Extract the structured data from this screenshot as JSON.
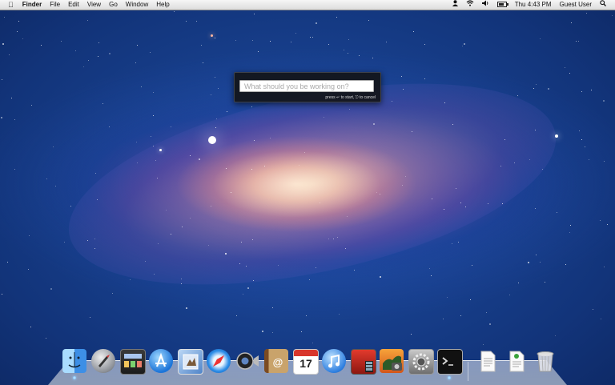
{
  "menubar": {
    "apple_icon": "apple-icon",
    "app_name": "Finder",
    "menus": [
      "File",
      "Edit",
      "View",
      "Go",
      "Window",
      "Help"
    ],
    "status": {
      "user_icon": "user-icon",
      "wifi_icon": "wifi-icon",
      "volume_icon": "volume-icon",
      "battery_icon": "battery-icon",
      "clock": "Thu 4:43 PM",
      "user": "Guest User",
      "search_icon": "spotlight-search-icon"
    }
  },
  "prompt": {
    "placeholder": "What should you be working on?",
    "value": "",
    "hint": "press ↵ to start, ⎋ to cancel"
  },
  "dock": {
    "items": [
      {
        "name": "finder",
        "icon": "finder-icon",
        "running": true
      },
      {
        "name": "launchpad",
        "icon": "launchpad-icon",
        "running": false
      },
      {
        "name": "mission-control",
        "icon": "mission-control-icon",
        "running": false
      },
      {
        "name": "app-store",
        "icon": "app-store-icon",
        "running": false
      },
      {
        "name": "preview",
        "icon": "preview-icon",
        "running": false
      },
      {
        "name": "safari",
        "icon": "safari-icon",
        "running": false
      },
      {
        "name": "facetime",
        "icon": "facetime-icon",
        "running": false
      },
      {
        "name": "address-book",
        "icon": "address-book-icon",
        "running": false
      },
      {
        "name": "ical",
        "icon": "calendar-icon",
        "running": false,
        "label": "17"
      },
      {
        "name": "itunes",
        "icon": "itunes-icon",
        "running": false
      },
      {
        "name": "photo-booth",
        "icon": "photo-booth-icon",
        "running": false
      },
      {
        "name": "iphoto",
        "icon": "iphoto-icon",
        "running": false
      },
      {
        "name": "system-preferences",
        "icon": "system-preferences-icon",
        "running": false
      },
      {
        "name": "terminal",
        "icon": "terminal-icon",
        "running": true
      },
      {
        "name": "documents-stack",
        "icon": "documents-stack-icon",
        "running": false
      },
      {
        "name": "downloads-stack",
        "icon": "downloads-stack-icon",
        "running": false
      },
      {
        "name": "trash",
        "icon": "trash-icon",
        "running": false
      }
    ]
  },
  "colors": {
    "sky_dark": "#0a1f52",
    "sky_mid": "#1f4fa6",
    "galaxy_core": "#ffe8cf",
    "running_indicator": "#66b6ff"
  }
}
